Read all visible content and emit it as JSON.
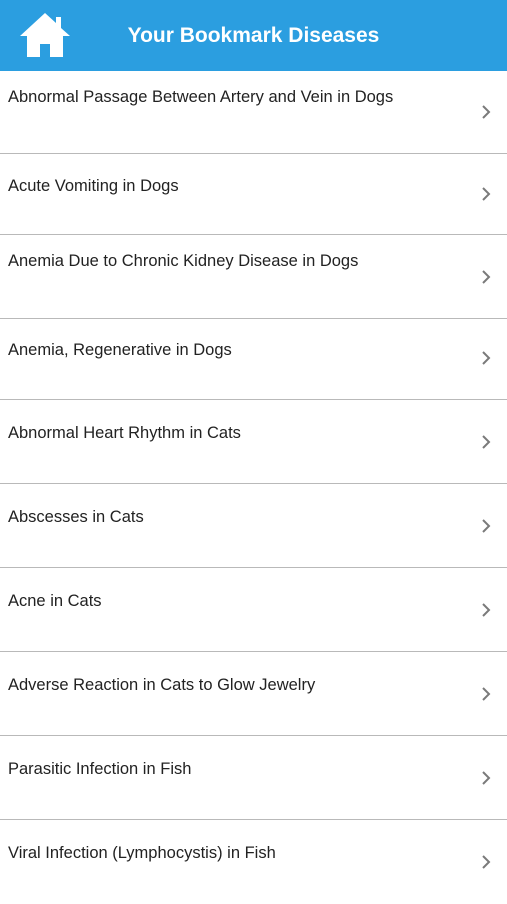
{
  "header": {
    "title": "Your Bookmark Diseases",
    "home_icon": "home-icon",
    "accent_color": "#2b9ee0"
  },
  "items": [
    {
      "label": "Abnormal Passage Between Artery and Vein in Dogs"
    },
    {
      "label": "Acute Vomiting in Dogs"
    },
    {
      "label": "Anemia Due to Chronic Kidney Disease in Dogs"
    },
    {
      "label": "Anemia, Regenerative in Dogs"
    },
    {
      "label": "Abnormal Heart Rhythm in Cats"
    },
    {
      "label": "Abscesses in Cats"
    },
    {
      "label": "Acne in Cats"
    },
    {
      "label": "Adverse Reaction in Cats to Glow Jewelry"
    },
    {
      "label": "Parasitic Infection in Fish"
    },
    {
      "label": "Viral Infection (Lymphocystis) in Fish"
    }
  ]
}
